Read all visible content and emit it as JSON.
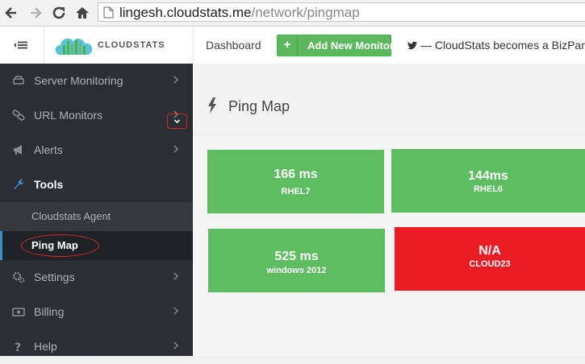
{
  "browser": {
    "url_host": "lingesh.cloudstats.me",
    "url_path": "/network/pingmap"
  },
  "header": {
    "brand": "CLOUDSTATS",
    "nav_dashboard": "Dashboard",
    "add_monitor_label": "Add New Monitor",
    "news_text": "— CloudStats becomes a BizPark"
  },
  "sidebar": {
    "items": [
      {
        "label": "Server Monitoring",
        "icon": "hdd-icon"
      },
      {
        "label": "URL Monitors",
        "icon": "link-icon"
      },
      {
        "label": "Alerts",
        "icon": "megaphone-icon"
      },
      {
        "label": "Tools",
        "icon": "wrench-icon"
      },
      {
        "label": "Settings",
        "icon": "cogs-icon"
      },
      {
        "label": "Billing",
        "icon": "money-icon"
      },
      {
        "label": "Help",
        "icon": "question-icon"
      }
    ],
    "subitems": [
      {
        "label": "Cloudstats Agent"
      },
      {
        "label": "Ping Map"
      }
    ]
  },
  "page": {
    "title": "Ping Map"
  },
  "tiles": [
    {
      "ping": "166 ms",
      "host": "RHEL7",
      "status": "ok"
    },
    {
      "ping": "144ms",
      "host": "RHEL6",
      "status": "ok"
    },
    {
      "ping": "525 ms",
      "host": "windows 2012",
      "status": "ok"
    },
    {
      "ping": "N/A",
      "host": "CLOUD23",
      "status": "down"
    }
  ],
  "colors": {
    "sidebar_bg": "#2b2e33",
    "ok_tile": "#5dbd60",
    "down_tile": "#ec1c24",
    "primary_button": "#5cb85c",
    "highlight": "#d9252a"
  }
}
